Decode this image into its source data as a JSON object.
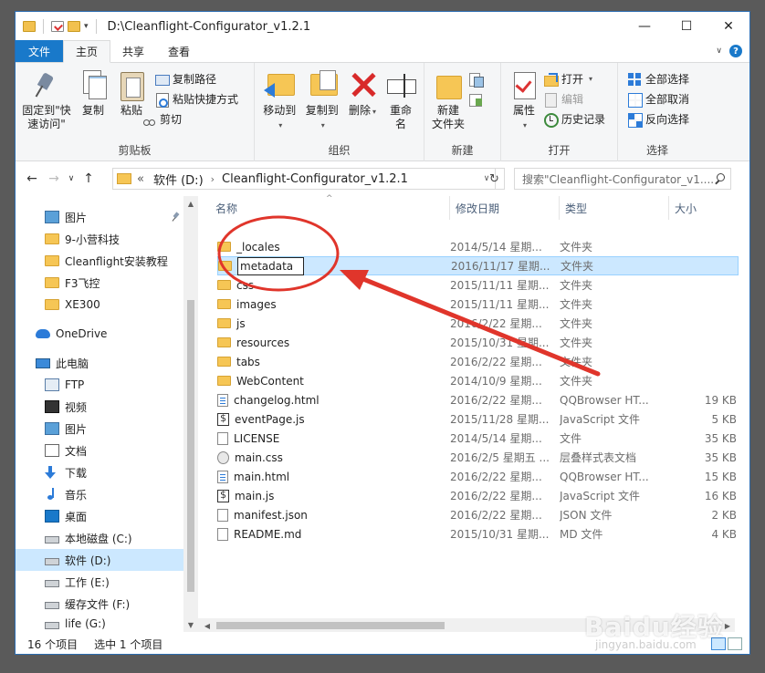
{
  "window": {
    "title": "D:\\Cleanflight-Configurator_v1.2.1",
    "minimize": "—",
    "maximize": "☐",
    "close": "✕"
  },
  "ribbon_tabs": [
    {
      "label": "文件"
    },
    {
      "label": "主页"
    },
    {
      "label": "共享"
    },
    {
      "label": "查看"
    }
  ],
  "ribbon": {
    "clipboard": {
      "label": "剪贴板",
      "pin": "固定到\"快\n速访问\"",
      "copy": "复制",
      "paste": "粘贴",
      "copy_path": "复制路径",
      "paste_shortcut": "粘贴快捷方式",
      "cut": "剪切"
    },
    "organize": {
      "label": "组织",
      "move_to": "移动到",
      "copy_to": "复制到",
      "delete": "删除",
      "rename": "重命名"
    },
    "new": {
      "label": "新建",
      "new_folder": "新建\n文件夹"
    },
    "open": {
      "label": "打开",
      "properties": "属性",
      "open": "打开",
      "edit": "编辑",
      "history": "历史记录"
    },
    "select": {
      "label": "选择",
      "select_all": "全部选择",
      "select_none": "全部取消",
      "invert": "反向选择"
    }
  },
  "address": {
    "prefix": "«",
    "drive": "软件 (D:)",
    "folder": "Cleanflight-Configurator_v1.2.1",
    "search_placeholder": "搜索\"Cleanflight-Configurator_v1...."
  },
  "nav": {
    "items": [
      {
        "label": "图片",
        "icon": "pictures-icon"
      },
      {
        "label": "9-小营科技",
        "icon": "folder-icon"
      },
      {
        "label": "Cleanflight安装教程",
        "icon": "folder-icon"
      },
      {
        "label": "F3飞控",
        "icon": "folder-icon"
      },
      {
        "label": "XE300",
        "icon": "folder-icon"
      },
      {
        "label": "OneDrive",
        "icon": "onedrive-icon"
      },
      {
        "label": "此电脑",
        "icon": "this-pc-icon"
      },
      {
        "label": "FTP",
        "icon": "ftp-icon"
      },
      {
        "label": "视频",
        "icon": "video-icon"
      },
      {
        "label": "图片",
        "icon": "pictures-icon"
      },
      {
        "label": "文档",
        "icon": "documents-icon"
      },
      {
        "label": "下载",
        "icon": "download-icon"
      },
      {
        "label": "音乐",
        "icon": "music-icon"
      },
      {
        "label": "桌面",
        "icon": "desktop-icon"
      },
      {
        "label": "本地磁盘 (C:)",
        "icon": "system-drive-icon"
      },
      {
        "label": "软件 (D:)",
        "icon": "drive-icon"
      },
      {
        "label": "工作 (E:)",
        "icon": "drive-icon"
      },
      {
        "label": "缓存文件 (F:)",
        "icon": "drive-icon"
      },
      {
        "label": "life (G:)",
        "icon": "drive-icon"
      }
    ]
  },
  "columns": {
    "name": "名称",
    "date": "修改日期",
    "type": "类型",
    "size": "大小"
  },
  "files": [
    {
      "name": "_locales",
      "date": "2014/5/14 星期...",
      "type": "文件夹",
      "size": "",
      "icon": "folder-icon"
    },
    {
      "name": "metadata",
      "date": "2016/11/17 星期...",
      "type": "文件夹",
      "size": "",
      "icon": "folder-icon"
    },
    {
      "name": "css",
      "date": "2015/11/11 星期...",
      "type": "文件夹",
      "size": "",
      "icon": "folder-icon"
    },
    {
      "name": "images",
      "date": "2015/11/11 星期...",
      "type": "文件夹",
      "size": "",
      "icon": "folder-icon"
    },
    {
      "name": "js",
      "date": "2016/2/22 星期...",
      "type": "文件夹",
      "size": "",
      "icon": "folder-icon"
    },
    {
      "name": "resources",
      "date": "2015/10/31 星期...",
      "type": "文件夹",
      "size": "",
      "icon": "folder-icon"
    },
    {
      "name": "tabs",
      "date": "2016/2/22 星期...",
      "type": "文件夹",
      "size": "",
      "icon": "folder-icon"
    },
    {
      "name": "WebContent",
      "date": "2014/10/9 星期...",
      "type": "文件夹",
      "size": "",
      "icon": "folder-icon"
    },
    {
      "name": "changelog.html",
      "date": "2016/2/22 星期...",
      "type": "QQBrowser HT...",
      "size": "19 KB",
      "icon": "html-file-icon"
    },
    {
      "name": "eventPage.js",
      "date": "2015/11/28 星期...",
      "type": "JavaScript 文件",
      "size": "5 KB",
      "icon": "js-file-icon"
    },
    {
      "name": "LICENSE",
      "date": "2014/5/14 星期...",
      "type": "文件",
      "size": "35 KB",
      "icon": "file-icon"
    },
    {
      "name": "main.css",
      "date": "2016/2/5 星期五 ...",
      "type": "层叠样式表文档",
      "size": "35 KB",
      "icon": "css-file-icon"
    },
    {
      "name": "main.html",
      "date": "2016/2/22 星期...",
      "type": "QQBrowser HT...",
      "size": "15 KB",
      "icon": "html-file-icon"
    },
    {
      "name": "main.js",
      "date": "2016/2/22 星期...",
      "type": "JavaScript 文件",
      "size": "16 KB",
      "icon": "js-file-icon"
    },
    {
      "name": "manifest.json",
      "date": "2016/2/22 星期...",
      "type": "JSON 文件",
      "size": "2 KB",
      "icon": "file-icon"
    },
    {
      "name": "README.md",
      "date": "2015/10/31 星期...",
      "type": "MD 文件",
      "size": "4 KB",
      "icon": "file-icon"
    }
  ],
  "status": {
    "count": "16 个项目",
    "selected": "选中 1 个项目"
  },
  "watermark": {
    "brand": "Baidu经验",
    "url": "jingyan.baidu.com"
  },
  "colors": {
    "accent": "#1979ca",
    "selection": "#cce8ff",
    "annotation": "#e0352b"
  }
}
